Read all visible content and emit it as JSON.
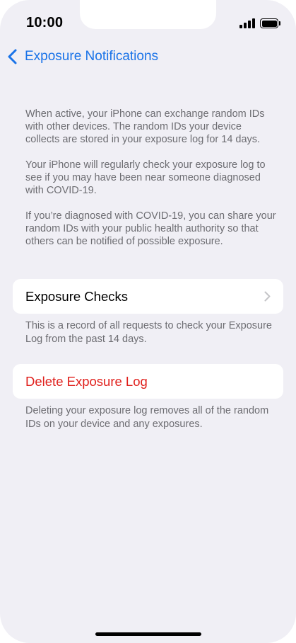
{
  "status_bar": {
    "time": "10:00",
    "signal_icon": "cellular-signal-icon",
    "battery_icon": "battery-icon"
  },
  "nav": {
    "back_icon": "chevron-left-icon",
    "title": "Exposure Notifications",
    "accent_color": "#1a73e8"
  },
  "intro": {
    "paragraphs": [
      "When active, your iPhone can exchange random IDs with other devices. The random IDs your device collects are stored in your exposure log for 14 days.",
      "Your iPhone will regularly check your exposure log to see if you may have been near someone diagnosed with COVID-19.",
      "If you’re diagnosed with COVID-19, you can share your random IDs with your public health authority so that others can be notified of possible exposure."
    ]
  },
  "exposure_checks": {
    "label": "Exposure Checks",
    "chevron_icon": "chevron-right-icon",
    "footer": "This is a record of all requests to check your Exposure Log from the past 14 days."
  },
  "delete_log": {
    "label": "Delete Exposure Log",
    "color": "#e0201c",
    "footer": "Deleting your exposure log removes all of the random IDs on your device and any exposures."
  }
}
